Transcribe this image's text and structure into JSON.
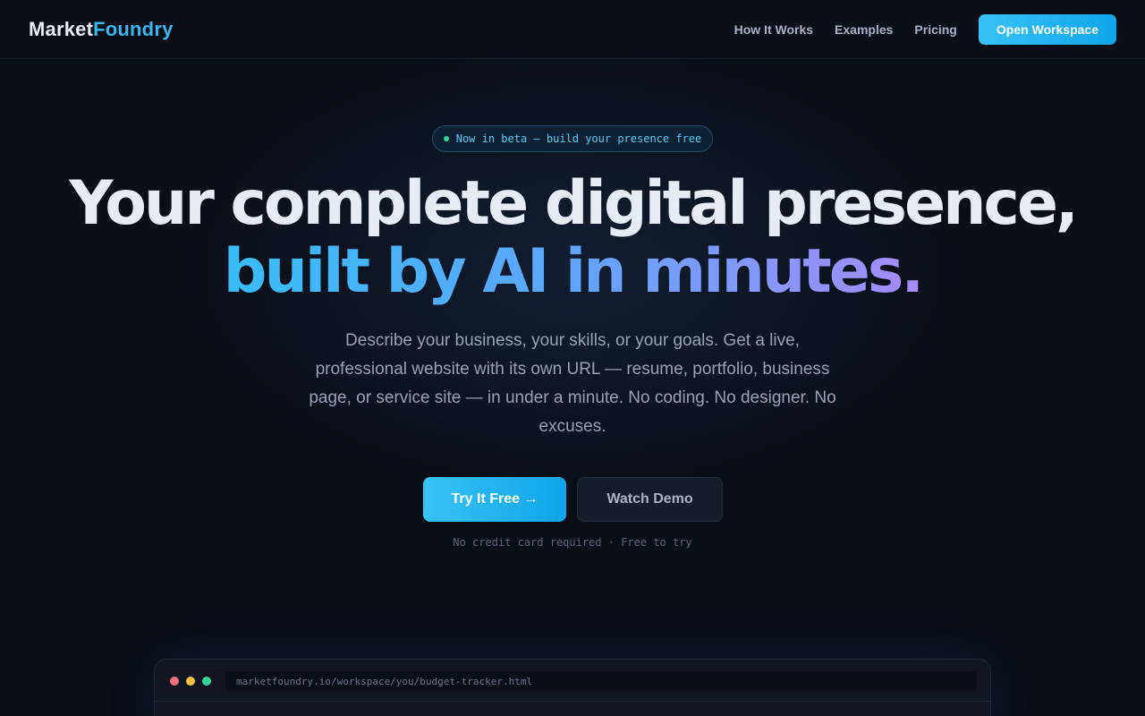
{
  "nav": {
    "logo_part1": "Market",
    "logo_part2": "Foundry",
    "links": [
      "How It Works",
      "Examples",
      "Pricing"
    ],
    "cta": "Open Workspace"
  },
  "hero": {
    "badge": "Now in beta — build your presence free",
    "headline_line1": "Your complete digital presence,",
    "headline_line2": "built by AI in minutes.",
    "subtitle": "Describe your business, your skills, or your goals. Get a live, professional website with its own URL — resume, portfolio, business page, or service site — in under a minute. No coding. No designer. No excuses.",
    "primary_button": "Try It Free →",
    "secondary_button": "Watch Demo",
    "fine_print": "No credit card required · Free to try"
  },
  "browser": {
    "url": "marketfoundry.io/workspace/you/budget-tracker.html"
  },
  "colors": {
    "accent": "#38bdf8",
    "background": "#0a0e17",
    "gradient_end": "#a78bfa"
  }
}
